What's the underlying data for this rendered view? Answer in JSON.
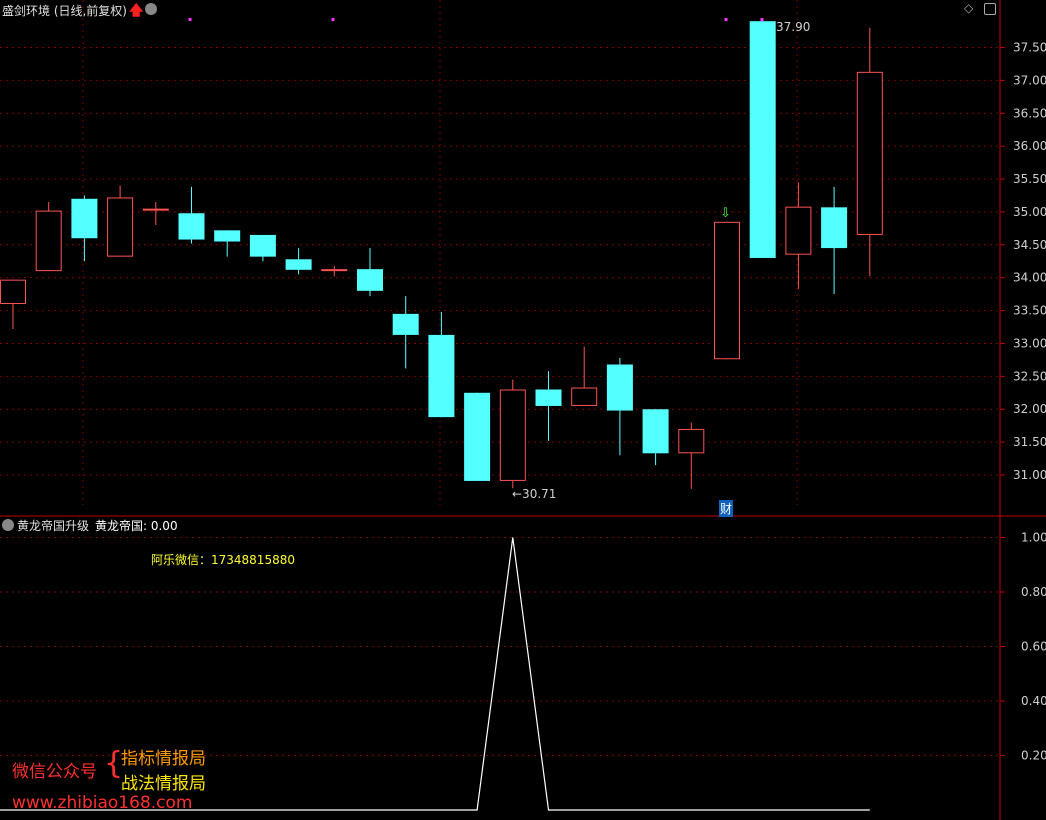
{
  "header": {
    "title": "盛剑环境 (日线,前复权)",
    "indicator_title": "黄龙帝国升级",
    "indicator_value_label": "黄龙帝国: 0.00",
    "contact": "阿乐微信：17348815880"
  },
  "watermark": {
    "account_label": "微信公众号",
    "line1": "指标情报局",
    "line2": "战法情报局",
    "site": "www.zhibiao168.com"
  },
  "markers": {
    "high_label": "37.90",
    "low_label": "←30.71",
    "cai_label": "财"
  },
  "colors": {
    "up": "#ff5252",
    "down": "#54ffff",
    "axis": "#c00000",
    "grid": "#7a0000",
    "indicator_line": "#ffffff",
    "contact": "#ffff33",
    "wm_red": "#ff3030",
    "wm_orange": "#ff9a00",
    "wm_yellow": "#ffe600"
  },
  "chart_data": [
    {
      "type": "candlestick",
      "ylim": [
        30.6,
        38.1
      ],
      "yticks": [
        "37.50",
        "37.00",
        "36.50",
        "36.00",
        "35.50",
        "35.00",
        "34.50",
        "34.00",
        "33.50",
        "33.00",
        "32.50",
        "32.00",
        "31.50",
        "31.00"
      ],
      "candles": [
        {
          "o": 33.6,
          "c": 33.97,
          "h": 33.97,
          "l": 33.22
        },
        {
          "o": 34.1,
          "c": 35.02,
          "h": 35.15,
          "l": 34.1
        },
        {
          "o": 35.2,
          "c": 34.6,
          "h": 35.25,
          "l": 34.25
        },
        {
          "o": 34.32,
          "c": 35.22,
          "h": 35.4,
          "l": 34.32
        },
        {
          "o": 35.05,
          "c": 35.05,
          "h": 35.15,
          "l": 34.8
        },
        {
          "o": 34.98,
          "c": 34.58,
          "h": 35.38,
          "l": 34.52
        },
        {
          "o": 34.72,
          "c": 34.55,
          "h": 34.72,
          "l": 34.32
        },
        {
          "o": 34.65,
          "c": 34.32,
          "h": 34.65,
          "l": 34.25
        },
        {
          "o": 34.28,
          "c": 34.12,
          "h": 34.45,
          "l": 34.05
        },
        {
          "o": 34.12,
          "c": 34.13,
          "h": 34.18,
          "l": 34.02
        },
        {
          "o": 34.13,
          "c": 33.8,
          "h": 34.45,
          "l": 33.72
        },
        {
          "o": 33.45,
          "c": 33.13,
          "h": 33.72,
          "l": 32.62
        },
        {
          "o": 33.13,
          "c": 31.88,
          "h": 33.48,
          "l": 31.88
        },
        {
          "o": 32.25,
          "c": 30.91,
          "h": 32.25,
          "l": 30.91
        },
        {
          "o": 30.91,
          "c": 32.3,
          "h": 32.45,
          "l": 30.8
        },
        {
          "o": 32.3,
          "c": 32.05,
          "h": 32.58,
          "l": 31.52
        },
        {
          "o": 32.05,
          "c": 32.33,
          "h": 32.95,
          "l": 32.05
        },
        {
          "o": 32.68,
          "c": 31.98,
          "h": 32.78,
          "l": 31.3
        },
        {
          "o": 32.0,
          "c": 31.33,
          "h": 32.0,
          "l": 31.15
        },
        {
          "o": 31.33,
          "c": 31.7,
          "h": 31.8,
          "l": 30.79
        },
        {
          "o": 32.76,
          "c": 34.85,
          "h": 34.85,
          "l": 32.76
        },
        {
          "o": 37.9,
          "c": 34.3,
          "h": 37.9,
          "l": 34.3
        },
        {
          "o": 34.35,
          "c": 35.08,
          "h": 35.45,
          "l": 33.83
        },
        {
          "o": 35.07,
          "c": 34.45,
          "h": 35.38,
          "l": 33.75
        },
        {
          "o": 34.65,
          "c": 37.13,
          "h": 37.8,
          "l": 34.02
        }
      ]
    },
    {
      "type": "line",
      "name": "黄龙帝国",
      "ylim": [
        0,
        1.05
      ],
      "yticks": [
        "1.00",
        "0.80",
        "0.60",
        "0.40",
        "0.20"
      ],
      "values": [
        0,
        0,
        0,
        0,
        0,
        0,
        0,
        0,
        0,
        0,
        0,
        0,
        0,
        0,
        1,
        0,
        0,
        0,
        0,
        0,
        0,
        0,
        0,
        0,
        0
      ]
    }
  ]
}
